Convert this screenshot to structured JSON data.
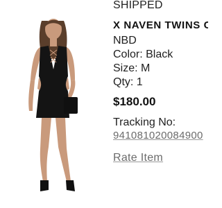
{
  "order_item": {
    "status": "SHIPPED",
    "title": "X NAVEN TWINS C",
    "brand": "NBD",
    "color_label": "Color: Black",
    "size_label": "Size: M",
    "qty_label": "Qty: 1",
    "price": "$180.00",
    "tracking_label": "Tracking No:",
    "tracking_number": "941081020084900",
    "rate_link": "Rate Item"
  },
  "product_image": {
    "icon": "product-photo",
    "dress_color": "#141414",
    "skin_color": "#c99a7c",
    "hair_color": "#5a3e2b"
  },
  "colors": {
    "text_primary": "#1f1f1f",
    "text_link": "#6b6b6b",
    "background": "#ffffff"
  }
}
